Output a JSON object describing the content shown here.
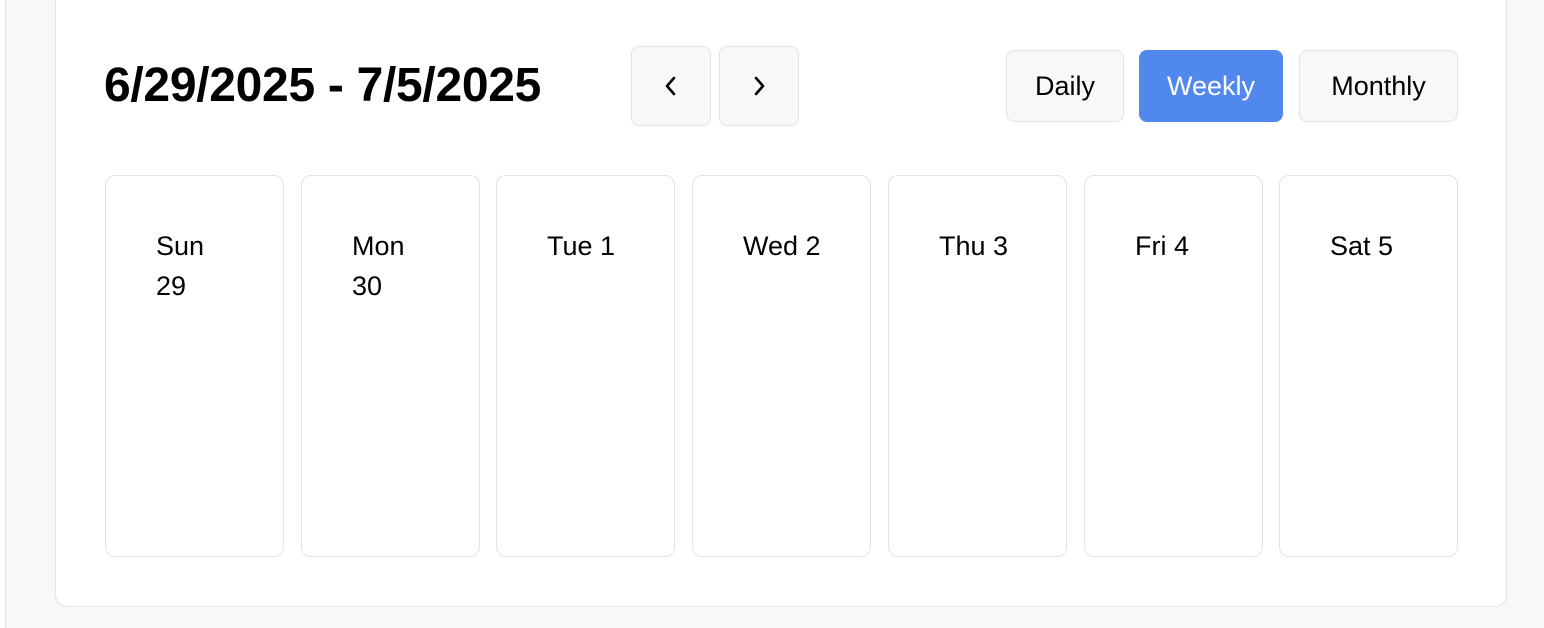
{
  "header": {
    "range_title": "6/29/2025 - 7/5/2025",
    "prev_icon": "chevron-left-icon",
    "next_icon": "chevron-right-icon"
  },
  "view_switcher": {
    "daily_label": "Daily",
    "weekly_label": "Weekly",
    "monthly_label": "Monthly",
    "selected": "Weekly",
    "active_color": "#5088ee"
  },
  "week": {
    "days": [
      {
        "label": "Sun 29"
      },
      {
        "label": "Mon 30"
      },
      {
        "label": "Tue 1"
      },
      {
        "label": "Wed 2"
      },
      {
        "label": "Thu 3"
      },
      {
        "label": "Fri 4"
      },
      {
        "label": "Sat 5"
      }
    ]
  }
}
